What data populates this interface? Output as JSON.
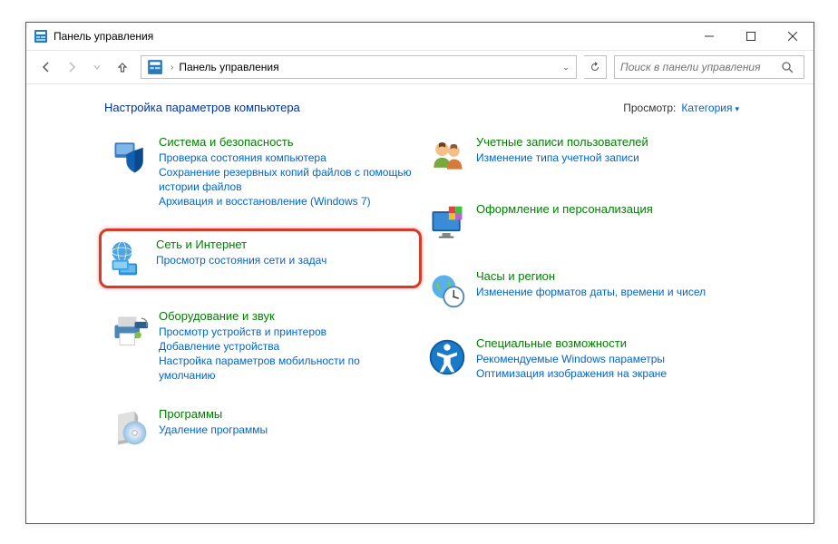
{
  "window": {
    "title": "Панель управления"
  },
  "nav": {
    "breadcrumb_root": "Панель управления",
    "search_placeholder": "Поиск в панели управления"
  },
  "header": {
    "heading": "Настройка параметров компьютера",
    "view_label": "Просмотр:",
    "view_value": "Категория"
  },
  "cats": {
    "system": {
      "title": "Система и безопасность",
      "l1": "Проверка состояния компьютера",
      "l2": "Сохранение резервных копий файлов с помощью истории файлов",
      "l3": "Архивация и восстановление (Windows 7)"
    },
    "network": {
      "title": "Сеть и Интернет",
      "l1": "Просмотр состояния сети и задач"
    },
    "hardware": {
      "title": "Оборудование и звук",
      "l1": "Просмотр устройств и принтеров",
      "l2": "Добавление устройства",
      "l3": "Настройка параметров мобильности по умолчанию"
    },
    "programs": {
      "title": "Программы",
      "l1": "Удаление программы"
    },
    "users": {
      "title": "Учетные записи пользователей",
      "l1": "Изменение типа учетной записи"
    },
    "personalization": {
      "title": "Оформление и персонализация"
    },
    "clock": {
      "title": "Часы и регион",
      "l1": "Изменение форматов даты, времени и чисел"
    },
    "ease": {
      "title": "Специальные возможности",
      "l1": "Рекомендуемые Windows параметры",
      "l2": "Оптимизация изображения на экране"
    }
  }
}
